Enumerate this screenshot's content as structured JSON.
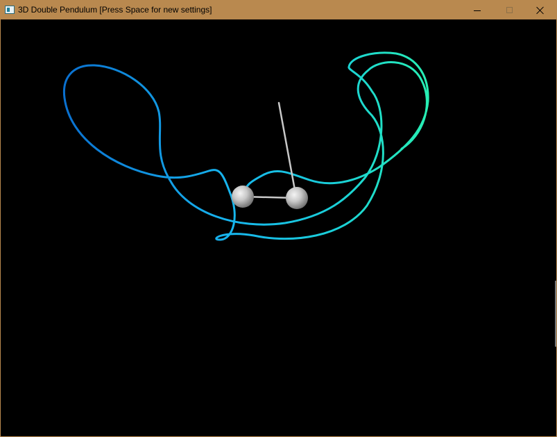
{
  "window": {
    "title": "3D Double Pendulum [Press Space for new settings]",
    "titlebar_color": "#b9894f",
    "icons": {
      "app": "app-window-icon",
      "minimize": "minimize-icon",
      "maximize": "maximize-icon",
      "close": "close-icon"
    }
  },
  "scene": {
    "background_color": "#000000",
    "trail_colors": {
      "start": "#0a70d0",
      "mid": "#17b4ee",
      "end": "#27eeb4"
    },
    "bob_color": "#d8d8d8",
    "rod_color": "#c8c8c8"
  }
}
